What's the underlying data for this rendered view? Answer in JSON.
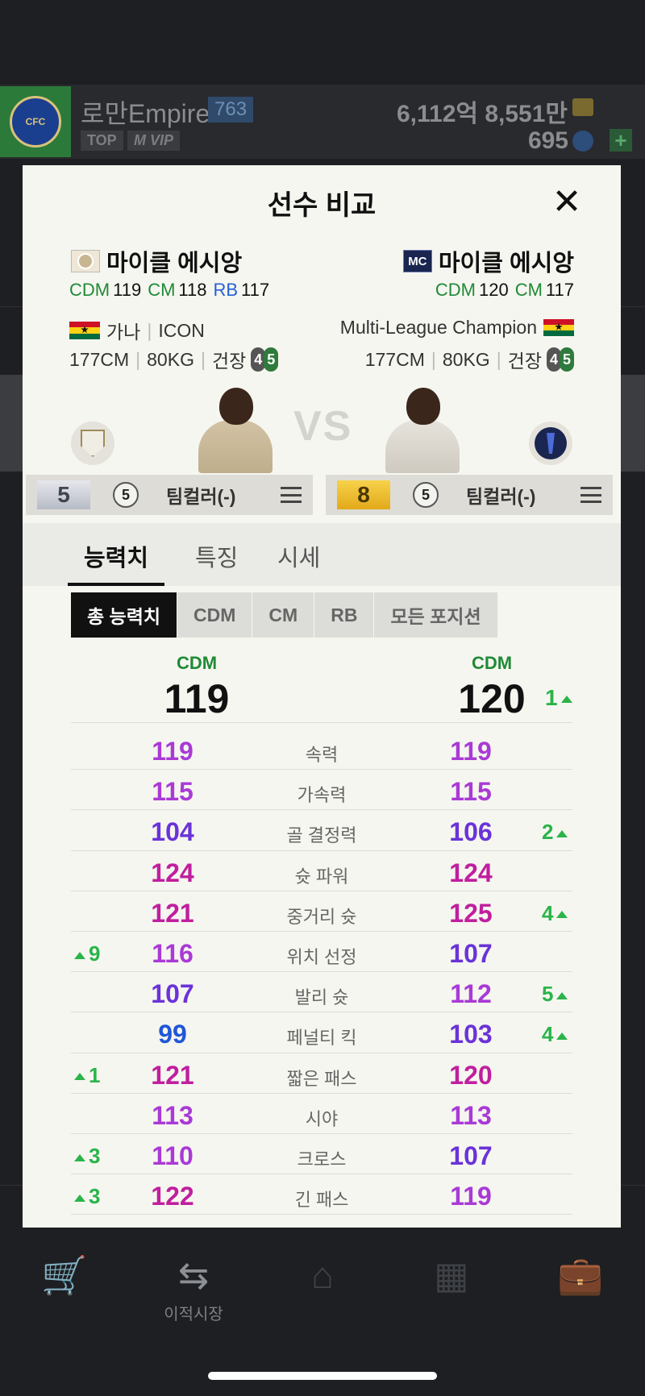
{
  "background": {
    "club_name": "로만Empire",
    "level": "763",
    "badges": [
      "TOP",
      "M VIP"
    ],
    "money": "6,112억 8,551만",
    "coins": "695",
    "plus": "+"
  },
  "bottom_nav": {
    "items": [
      {
        "icon": "cart-icon",
        "label": ""
      },
      {
        "icon": "transfer-icon",
        "label": "이적시장"
      },
      {
        "icon": "home-icon",
        "label": ""
      },
      {
        "icon": "formation-icon",
        "label": ""
      },
      {
        "icon": "briefcase-icon",
        "label": ""
      }
    ]
  },
  "modal": {
    "title": "선수 비교",
    "close": "✕",
    "vs": "VS",
    "left": {
      "name": "마이클 에시앙",
      "positions": [
        {
          "pos": "CDM",
          "val": "119",
          "color": "green"
        },
        {
          "pos": "CM",
          "val": "118",
          "color": "green"
        },
        {
          "pos": "RB",
          "val": "117",
          "color": "blue"
        }
      ],
      "nation": "가나",
      "season": "ICON",
      "height": "177CM",
      "weight": "80KG",
      "health_label": "건장",
      "health": [
        "4",
        "5"
      ],
      "grade": "5",
      "level": "5",
      "team_color": "팀컬러(-)"
    },
    "right": {
      "name": "마이클 에시앙",
      "season_badge": "MC",
      "positions": [
        {
          "pos": "CDM",
          "val": "120",
          "color": "green"
        },
        {
          "pos": "CM",
          "val": "117",
          "color": "green"
        }
      ],
      "season": "Multi-League Champion",
      "height": "177CM",
      "weight": "80KG",
      "health_label": "건장",
      "health": [
        "4",
        "5"
      ],
      "grade": "8",
      "level": "5",
      "team_color": "팀컬러(-)"
    },
    "tabs": [
      "능력치",
      "특징",
      "시세"
    ],
    "sub_tabs": [
      "총 능력치",
      "CDM",
      "CM",
      "RB",
      "모든 포지션"
    ],
    "overall": {
      "left_pos": "CDM",
      "left_val": "119",
      "right_pos": "CDM",
      "right_val": "120",
      "right_diff": "1"
    },
    "stats": [
      {
        "name": "속력",
        "left": "119",
        "right": "119",
        "lc": "#a93ad6",
        "rc": "#a93ad6",
        "ld": "",
        "rd": ""
      },
      {
        "name": "가속력",
        "left": "115",
        "right": "115",
        "lc": "#a93ad6",
        "rc": "#a93ad6",
        "ld": "",
        "rd": ""
      },
      {
        "name": "골 결정력",
        "left": "104",
        "right": "106",
        "lc": "#6a33d8",
        "rc": "#6a33d8",
        "ld": "",
        "rd": "2"
      },
      {
        "name": "슛 파워",
        "left": "124",
        "right": "124",
        "lc": "#c01f9e",
        "rc": "#c01f9e",
        "ld": "",
        "rd": ""
      },
      {
        "name": "중거리 슛",
        "left": "121",
        "right": "125",
        "lc": "#c01f9e",
        "rc": "#c01f9e",
        "ld": "",
        "rd": "4"
      },
      {
        "name": "위치 선정",
        "left": "116",
        "right": "107",
        "lc": "#a93ad6",
        "rc": "#6a33d8",
        "ld": "9",
        "rd": ""
      },
      {
        "name": "발리 슛",
        "left": "107",
        "right": "112",
        "lc": "#6a33d8",
        "rc": "#a93ad6",
        "ld": "",
        "rd": "5"
      },
      {
        "name": "페널티 킥",
        "left": "99",
        "right": "103",
        "lc": "#1f57d8",
        "rc": "#6a33d8",
        "ld": "",
        "rd": "4"
      },
      {
        "name": "짧은 패스",
        "left": "121",
        "right": "120",
        "lc": "#c01f9e",
        "rc": "#c01f9e",
        "ld": "1",
        "rd": ""
      },
      {
        "name": "시야",
        "left": "113",
        "right": "113",
        "lc": "#a93ad6",
        "rc": "#a93ad6",
        "ld": "",
        "rd": ""
      },
      {
        "name": "크로스",
        "left": "110",
        "right": "107",
        "lc": "#a93ad6",
        "rc": "#6a33d8",
        "ld": "3",
        "rd": ""
      },
      {
        "name": "긴 패스",
        "left": "122",
        "right": "119",
        "lc": "#c01f9e",
        "rc": "#a93ad6",
        "ld": "3",
        "rd": ""
      }
    ]
  }
}
